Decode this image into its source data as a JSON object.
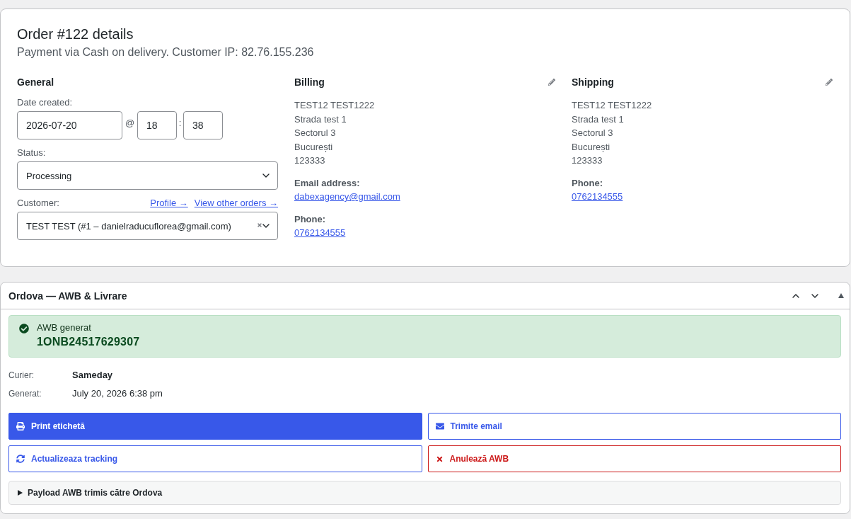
{
  "order": {
    "title": "Order #122 details",
    "subtitle": "Payment via Cash on delivery. Customer IP: 82.76.155.236"
  },
  "general": {
    "heading": "General",
    "date_label": "Date created:",
    "date": "2026-07-20",
    "at": "@",
    "hour": "18",
    "time_separator": ":",
    "minute": "38",
    "status_label": "Status:",
    "status": "Processing",
    "customer_label": "Customer:",
    "customer_links": [
      "Profile →",
      "View other orders →"
    ],
    "customer": "TEST TEST (#1 – danielraducuflorea@gmail.com)"
  },
  "billing": {
    "heading": "Billing",
    "address": [
      "TEST12 TEST1222",
      "Strada test 1",
      "Sectorul 3",
      "București",
      "123333"
    ],
    "contacts": [
      {
        "label": "Email address:",
        "value": "dabexagency@gmail.com"
      },
      {
        "label": "Phone:",
        "value": "0762134555"
      }
    ]
  },
  "shipping": {
    "heading": "Shipping",
    "address": [
      "TEST12 TEST1222",
      "Strada test 1",
      "Sectorul 3",
      "București",
      "123333"
    ],
    "contacts": [
      {
        "label": "Phone:",
        "value": "0762134555"
      }
    ]
  },
  "awb_panel": {
    "title": "Ordova — AWB & Livrare",
    "expanded": true,
    "notice": {
      "title": "AWB generat",
      "code": "1ONB24517629307"
    },
    "details": [
      {
        "label": "Curier:",
        "value": "Sameday",
        "emphasis": true
      },
      {
        "label": "Generat:",
        "value": "July 20, 2026 6:38 pm",
        "emphasis": false
      }
    ],
    "actions": [
      {
        "label": "Print etichetă",
        "kind": "print"
      },
      {
        "label": "Trimite email",
        "kind": "email"
      },
      {
        "label": "Actualizeaza tracking",
        "kind": "refresh"
      },
      {
        "label": "Anulează AWB",
        "kind": "cancel"
      }
    ],
    "payload": {
      "summary": "Payload AWB trimis către Ordova",
      "expanded": false
    }
  }
}
